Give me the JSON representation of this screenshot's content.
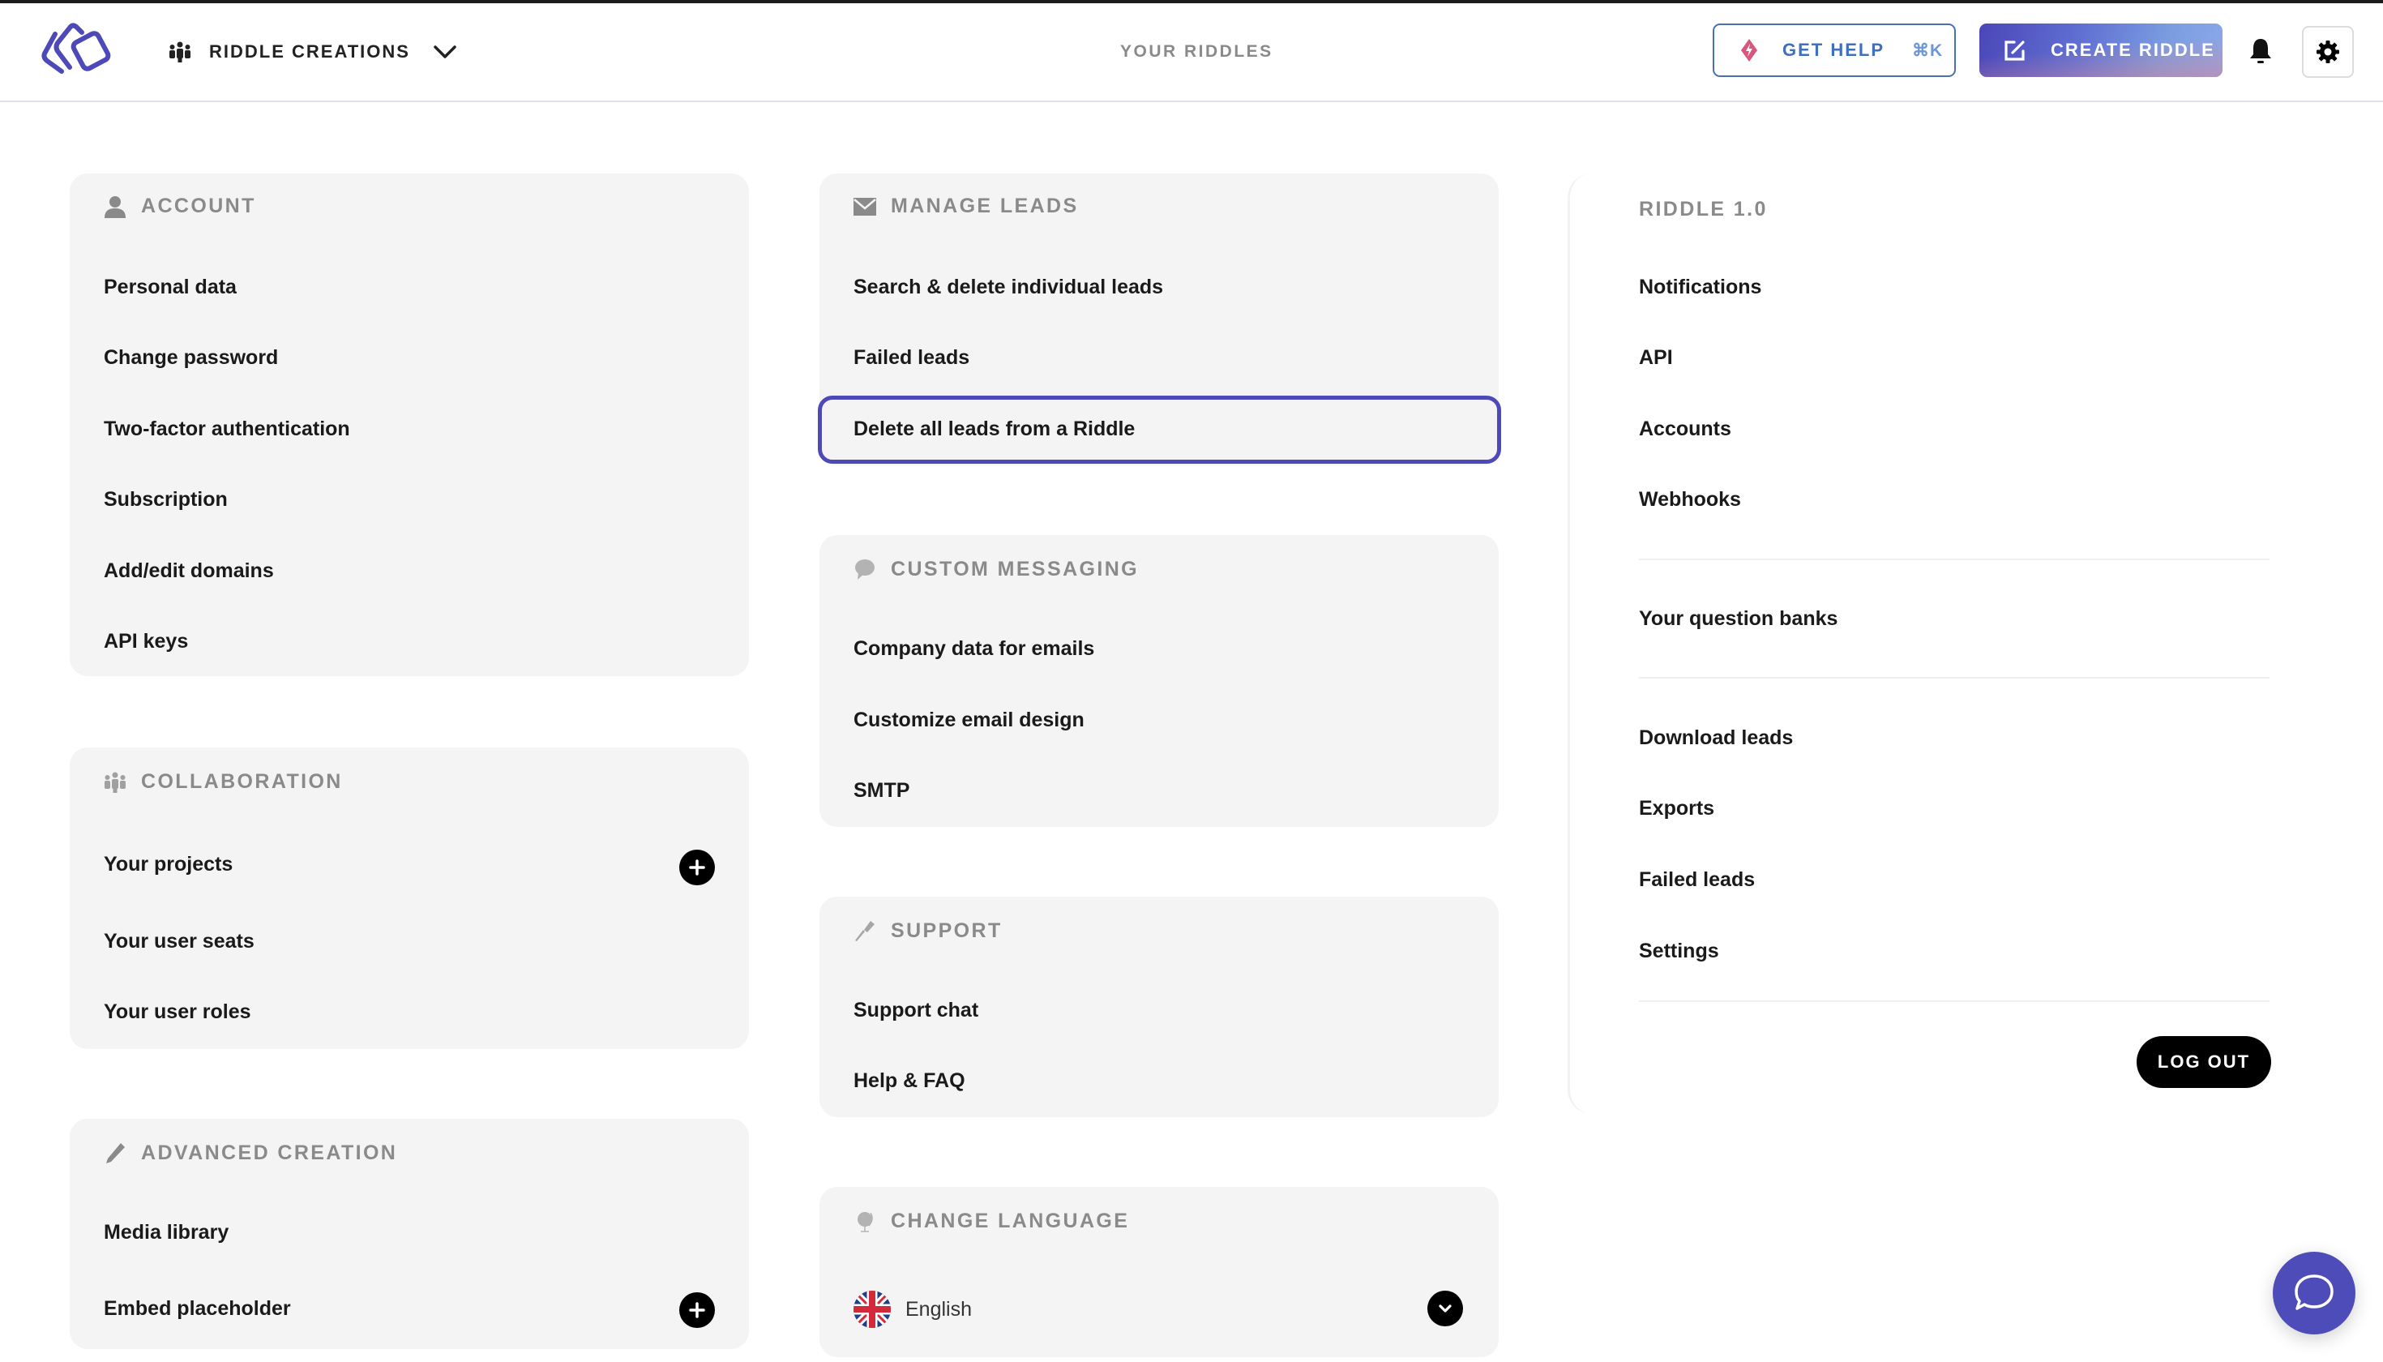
{
  "header": {
    "workspace_label": "RIDDLE CREATIONS",
    "nav_center": "YOUR RIDDLES",
    "get_help_label": "GET HELP",
    "get_help_shortcut": "⌘K",
    "create_label": "CREATE RIDDLE"
  },
  "colors": {
    "accent": "#4e49b9",
    "help_text": "#3f6fbd",
    "card_bg": "#f4f4f4",
    "section_title": "#8a8a8a"
  },
  "account": {
    "title": "ACCOUNT",
    "items": [
      "Personal data",
      "Change password",
      "Two-factor authentication",
      "Subscription",
      "Add/edit domains",
      "API keys"
    ]
  },
  "collaboration": {
    "title": "COLLABORATION",
    "items": [
      "Your projects",
      "Your user seats",
      "Your user roles"
    ]
  },
  "advanced_creation": {
    "title": "ADVANCED CREATION",
    "items": [
      "Media library",
      "Embed placeholder"
    ]
  },
  "manage_leads": {
    "title": "MANAGE LEADS",
    "items": [
      "Search & delete individual leads",
      "Failed leads",
      "Delete all leads from a Riddle"
    ],
    "focused_item": "Delete all leads from a Riddle"
  },
  "custom_messaging": {
    "title": "CUSTOM MESSAGING",
    "items": [
      "Company data for emails",
      "Customize email design",
      "SMTP"
    ]
  },
  "support": {
    "title": "SUPPORT",
    "items": [
      "Support chat",
      "Help & FAQ"
    ]
  },
  "change_language": {
    "title": "CHANGE LANGUAGE",
    "selected": "English"
  },
  "riddle1": {
    "title": "RIDDLE 1.0",
    "group1": [
      "Notifications",
      "API",
      "Accounts",
      "Webhooks"
    ],
    "group2": [
      "Your question banks"
    ],
    "group3": [
      "Download leads",
      "Exports",
      "Failed leads",
      "Settings"
    ],
    "logout_label": "LOG OUT"
  }
}
